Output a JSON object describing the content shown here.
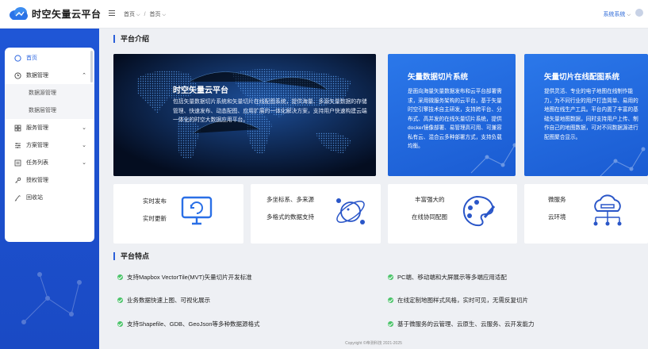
{
  "app": {
    "title": "时空矢量云平台"
  },
  "header": {
    "breadcrumb": [
      "首页",
      "首页"
    ],
    "system_settings": "系统系统"
  },
  "sidebar": {
    "items": [
      {
        "label": "首页",
        "icon": "home-icon",
        "active": true
      },
      {
        "label": "数据管理",
        "icon": "clock-icon",
        "expanded": true
      },
      {
        "label": "数据源管理",
        "sub": true
      },
      {
        "label": "数据层管理",
        "sub": true
      },
      {
        "label": "服务管理",
        "icon": "grid-icon"
      },
      {
        "label": "方案管理",
        "icon": "sliders-icon"
      },
      {
        "label": "任务列表",
        "icon": "list-icon"
      },
      {
        "label": "授权管理",
        "icon": "key-icon"
      },
      {
        "label": "回收站",
        "icon": "trash-icon"
      }
    ]
  },
  "platform_intro": {
    "title": "平台介绍",
    "hero": {
      "title": "时空矢量云平台",
      "desc": "包括矢量数据切片系统和矢量切片在线配图系统，提供海量、多源矢量数据的存储管理、快速发布、动态配图、应用扩展的一体化解决方案，支持用户快速构建云端一体化的时空大数据应用平台。"
    },
    "card1": {
      "title": "矢量数据切片系统",
      "desc": "是面向海量矢量数据发布和云平台部署需求，采用微服务架构的云平台，基于矢量时空引擎技术自主研发，支持跨平台、分布式、高并发的在线矢量切片系统，提供docker镜像部署、易管理高可用、可兼容私有云、混合云多种部署方式，支持负载均衡。"
    },
    "card2": {
      "title": "矢量切片在线配图系统",
      "desc": "提供灵活、专业的电子地图在线制作能力，为不同行业的用户打造简单、易用的地图在线生产工具。平台内置了丰富的基础矢量地图数据，同时支持用户上传、制作自己的地图数据，可对不同数据源进行配图聚合显示。"
    }
  },
  "feature_cards": [
    {
      "line1": "实时发布",
      "line2": "实时更新",
      "icon": "monitor-refresh-icon"
    },
    {
      "line1": "多坐标系、多来源",
      "line2": "多格式的数据支持",
      "icon": "orbit-globe-icon"
    },
    {
      "line1": "丰富强大的",
      "line2": "在线协同配图",
      "icon": "palette-icon"
    },
    {
      "line1": "微服务",
      "line2": "云环境",
      "icon": "cloud-server-icon"
    }
  ],
  "platform_features": {
    "title": "平台特点",
    "items": [
      "支持Mapbox VectorTile(MVT)矢量切片开发标准",
      "PC端、移动端和大屏展示等多端应用适配",
      "业务数据快速上图、可视化展示",
      "在线定制地图样式风格，实时可见，无需反复切片",
      "支持Shapefile、GDB、GeoJson等多种数据源格式",
      "基于微服务的云管理、云原生、云服务、云开发能力"
    ]
  },
  "footer": {
    "copyright": "Copyright ©帝测科技 2021-2025"
  },
  "colors": {
    "primary": "#2b5fd9",
    "sidebar": "#1f56d6",
    "card_blue": "#2266de",
    "check": "#4cc46a"
  }
}
